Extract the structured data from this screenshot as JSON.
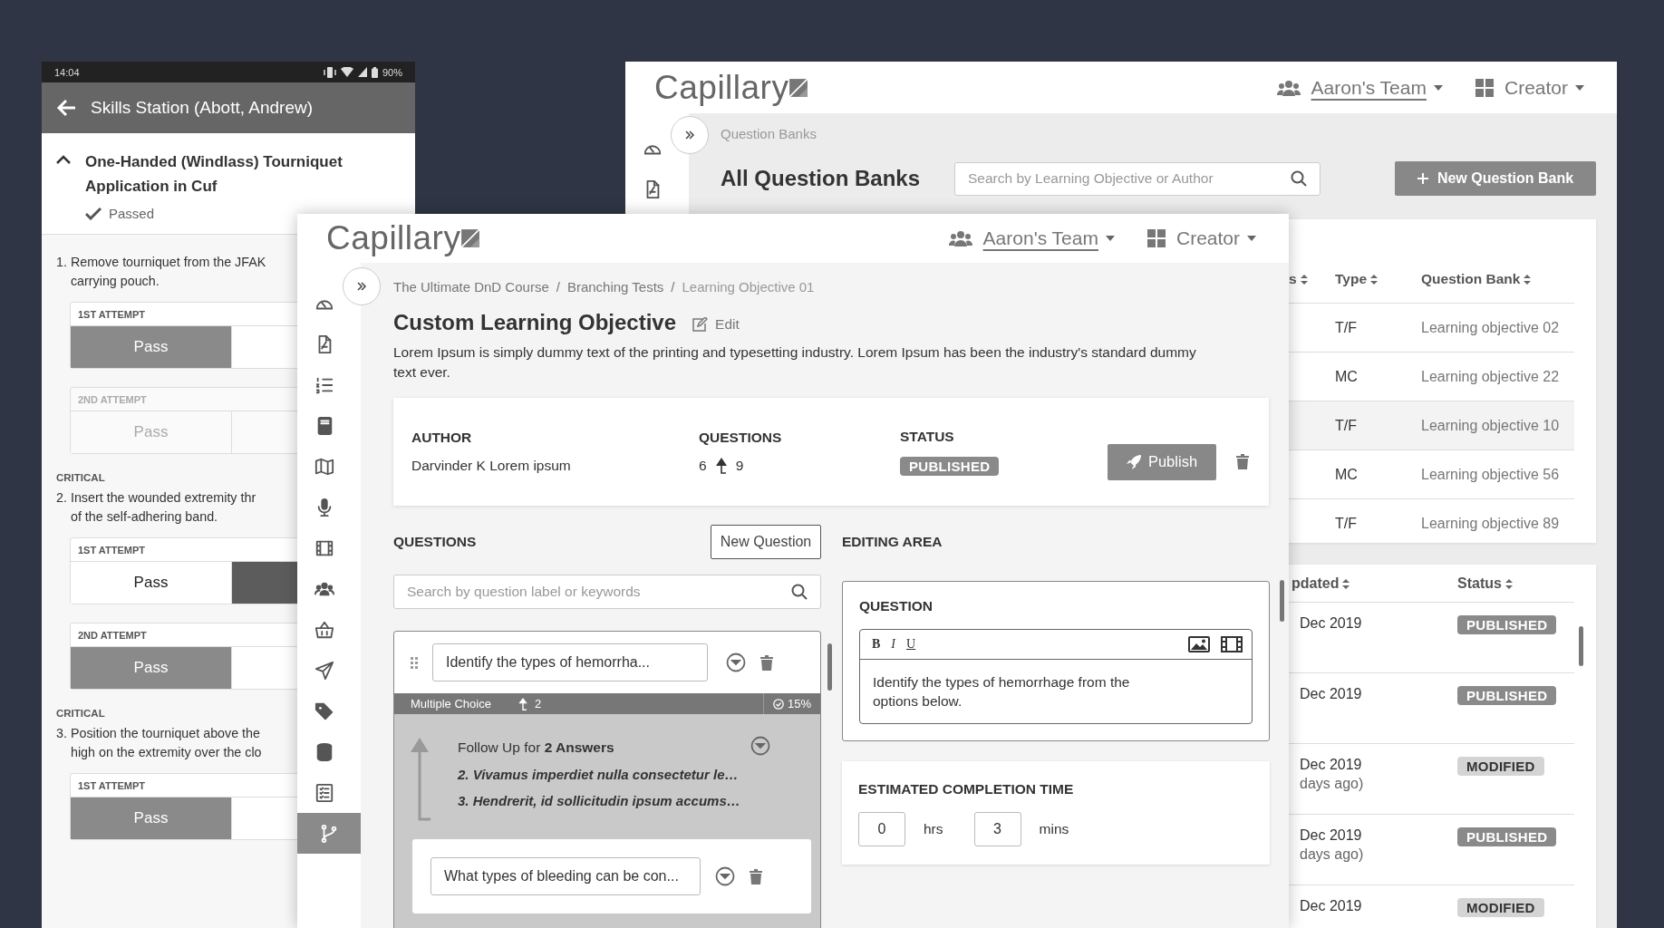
{
  "phone": {
    "status_bar": {
      "time": "14:04",
      "battery": "90%"
    },
    "title": "Skills Station (Abott, Andrew)",
    "skill": {
      "title": "One-Handed (Windlass) Tourniquet Application in Cuf",
      "expanded": true,
      "status": "Passed"
    },
    "steps": [
      {
        "number": "1.",
        "lines": [
          "Remove tourniquet from the JFAK",
          "carrying pouch."
        ],
        "attempts": [
          {
            "label": "1ST ATTEMPT",
            "disabled": false,
            "options": [
              {
                "label": "Pass",
                "selected": true
              },
              {
                "selected": false
              }
            ]
          },
          {
            "label": "2ND ATTEMPT",
            "disabled": true,
            "options": [
              {
                "label": "Pass",
                "selected": false
              },
              {
                "selected": false
              }
            ]
          }
        ]
      },
      {
        "tag": "CRITICAL",
        "number": "2.",
        "lines": [
          "Insert the wounded extremity thr",
          "of the self-adhering band."
        ],
        "attempts": [
          {
            "label": "1ST ATTEMPT",
            "disabled": false,
            "options": [
              {
                "label": "Pass",
                "selected": false
              },
              {
                "selected": true
              }
            ]
          },
          {
            "label": "2ND ATTEMPT",
            "disabled": false,
            "options": [
              {
                "label": "Pass",
                "selected": true
              },
              {
                "selected": false
              }
            ]
          }
        ]
      },
      {
        "tag": "CRITICAL",
        "number": "3.",
        "lines": [
          "Position the tourniquet above the",
          "high on the extremity over the clo"
        ],
        "attempts": [
          {
            "label": "1ST ATTEMPT",
            "disabled": false,
            "options": [
              {
                "label": "Pass",
                "selected": true
              },
              {
                "selected": false
              }
            ]
          }
        ]
      }
    ]
  },
  "back_window": {
    "logo": "Capillary",
    "team": "Aaron's Team",
    "role": "Creator",
    "nav_items": [
      {
        "selected": false
      },
      {
        "selected": false
      }
    ],
    "breadcrumb": "Question Banks",
    "title": "All Question Banks",
    "search": {
      "placeholder": "Search by Learning Objective or Author"
    },
    "new_button": "New Question Bank",
    "banks_table": {
      "columns": [
        "s",
        "Type",
        "Question Bank"
      ],
      "rows": [
        {
          "type": "T/F",
          "bank": "Learning objective 02",
          "selected": false
        },
        {
          "type": "MC",
          "bank": "Learning objective 22",
          "selected": false
        },
        {
          "type": "T/F",
          "bank": "Learning objective 10",
          "selected": true
        },
        {
          "type": "MC",
          "bank": "Learning objective 56",
          "selected": false
        },
        {
          "type": "T/F",
          "bank": "Learning objective 89",
          "selected": false
        }
      ]
    },
    "status_table": {
      "columns": [
        "pdated",
        "Status"
      ],
      "rows": [
        {
          "updated": "Dec 2019",
          "status": "PUBLISHED",
          "kind": "published"
        },
        {
          "updated": "Dec 2019",
          "status": "PUBLISHED",
          "kind": "published"
        },
        {
          "updated": "Dec 2019",
          "ago": "days ago)",
          "status": "MODIFIED",
          "kind": "modified"
        },
        {
          "updated": "Dec 2019",
          "ago": "days ago)",
          "status": "PUBLISHED",
          "kind": "published"
        },
        {
          "updated": "Dec 2019",
          "status": "MODIFIED",
          "kind": "modified"
        }
      ]
    }
  },
  "front_window": {
    "logo": "Capillary",
    "team": "Aaron's Team",
    "role": "Creator",
    "nav_items": [
      {
        "selected": false
      },
      {
        "selected": false
      },
      {
        "selected": false
      },
      {
        "selected": false
      },
      {
        "selected": false
      },
      {
        "selected": false
      },
      {
        "selected": false
      },
      {
        "selected": false
      },
      {
        "selected": false
      },
      {
        "selected": false
      },
      {
        "selected": false
      },
      {
        "selected": false
      },
      {
        "selected": false
      },
      {
        "selected": true
      }
    ],
    "breadcrumb": {
      "separator": "/",
      "items": [
        {
          "label": "The Ultimate DnD Course",
          "current": false
        },
        {
          "label": "Branching Tests",
          "current": false
        },
        {
          "label": "Learning Objective 01",
          "current": true
        }
      ]
    },
    "title": "Custom Learning Objective",
    "edit": "Edit",
    "description": "Lorem Ipsum is simply dummy text of the printing and typesetting industry. Lorem Ipsum has been the industry's standard dummy text ever.",
    "info": {
      "author_label": "AUTHOR",
      "author": "Darvinder K Lorem ipsum",
      "questions_label": "QUESTIONS",
      "questions": "6",
      "followups": "9",
      "status_label": "STATUS",
      "status": "PUBLISHED",
      "publish": "Publish"
    },
    "questions": {
      "label": "QUESTIONS",
      "new_button": "New Question",
      "search": {
        "placeholder": "Search by question label or keywords"
      },
      "items": [
        {
          "value": "Identify the types of hemorrha...",
          "type": "Multiple Choice",
          "followups": "2",
          "score": "15%",
          "expanded": true,
          "follow_up": {
            "title": "Follow Up for **2 Answers**",
            "answers": [
              "2. Vivamus imperdiet nulla consectetur le…",
              "3. Hendrerit, id sollicitudin ipsum accums…"
            ],
            "children": [
              {
                "value": "What types of bleeding can be con..."
              }
            ]
          }
        }
      ]
    },
    "editing": {
      "label": "EDITING AREA",
      "question": {
        "label": "QUESTION",
        "toolbar": [
          "B",
          "I",
          "U"
        ],
        "text": "Identify the types of hemorrhage from the options below."
      },
      "time": {
        "label": "ESTIMATED COMPLETION TIME",
        "hours": "0",
        "hours_unit": "hrs",
        "minutes": "3",
        "minutes_unit": "mins"
      }
    }
  }
}
